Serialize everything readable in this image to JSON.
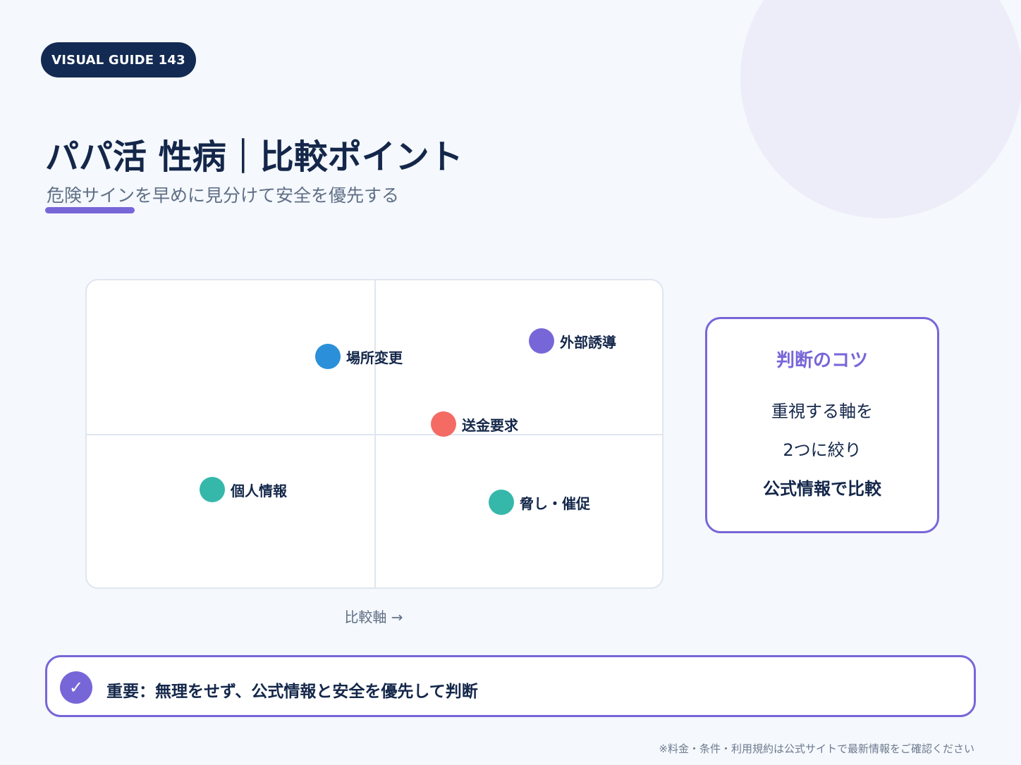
{
  "badge": "VISUAL GUIDE 143",
  "title": "パパ活 性病｜比較ポイント",
  "subtitle": "危険サインを早めに見分けて安全を優先する",
  "chart": {
    "x_axis_label": "比較軸 →",
    "points": [
      {
        "label": "場所変更",
        "color": "#2b8fd9"
      },
      {
        "label": "外部誘導",
        "color": "#7766d8"
      },
      {
        "label": "送金要求",
        "color": "#f46b64"
      },
      {
        "label": "個人情報",
        "color": "#35b8aa"
      },
      {
        "label": "脅し・催促",
        "color": "#35b8aa"
      }
    ]
  },
  "tip": {
    "title": "判断のコツ",
    "line1": "重視する軸を",
    "line2": "2つに絞り",
    "line3": "公式情報で比較"
  },
  "banner": {
    "icon": "check-icon",
    "text": "重要：無理をせず、公式情報と安全を優先して判断"
  },
  "footnote": "※料金・条件・利用規約は公式サイトで最新情報をご確認ください",
  "colors": {
    "accent": "#7766d8",
    "navy": "#132a52",
    "background": "#f5f8fc"
  }
}
